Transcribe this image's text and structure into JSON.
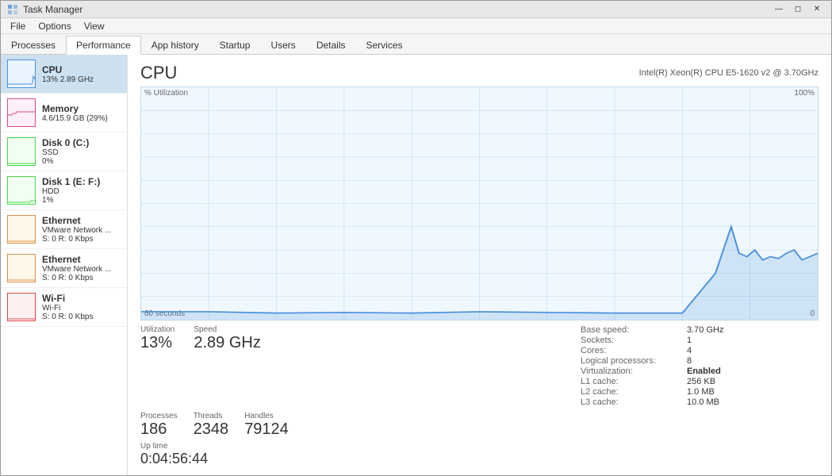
{
  "window": {
    "title": "Task Manager"
  },
  "menu": {
    "items": [
      "File",
      "Options",
      "View"
    ]
  },
  "tabs": [
    {
      "label": "Processes",
      "active": false
    },
    {
      "label": "Performance",
      "active": true
    },
    {
      "label": "App history",
      "active": false
    },
    {
      "label": "Startup",
      "active": false
    },
    {
      "label": "Users",
      "active": false
    },
    {
      "label": "Details",
      "active": false
    },
    {
      "label": "Services",
      "active": false
    }
  ],
  "sidebar": {
    "items": [
      {
        "id": "cpu",
        "title": "CPU",
        "sub": "13%  2.89 GHz",
        "active": true
      },
      {
        "id": "memory",
        "title": "Memory",
        "sub": "4.6/15.9 GB (29%)",
        "active": false
      },
      {
        "id": "disk0",
        "title": "Disk 0 (C:)",
        "sub1": "SSD",
        "sub2": "0%",
        "active": false
      },
      {
        "id": "disk1",
        "title": "Disk 1 (E: F:)",
        "sub1": "HDD",
        "sub2": "1%",
        "active": false
      },
      {
        "id": "eth1",
        "title": "Ethernet",
        "sub1": "VMware Network ...",
        "sub2": "S: 0  R: 0 Kbps",
        "active": false
      },
      {
        "id": "eth2",
        "title": "Ethernet",
        "sub1": "VMware Network ...",
        "sub2": "S: 0  R: 0 Kbps",
        "active": false
      },
      {
        "id": "wifi",
        "title": "Wi-Fi",
        "sub1": "Wi-Fi",
        "sub2": "S: 0  R: 0 Kbps",
        "active": false
      }
    ]
  },
  "detail": {
    "title": "CPU",
    "cpu_name": "Intel(R) Xeon(R) CPU E5-1620 v2 @ 3.70GHz",
    "chart_label_x": "% Utilization",
    "chart_label_60s": "60 seconds",
    "chart_pct_100": "100%",
    "chart_pct_0": "0",
    "utilization_label": "Utilization",
    "utilization_value": "13%",
    "speed_label": "Speed",
    "speed_value": "2.89 GHz",
    "processes_label": "Processes",
    "processes_value": "186",
    "threads_label": "Threads",
    "threads_value": "2348",
    "handles_label": "Handles",
    "handles_value": "79124",
    "uptime_label": "Up time",
    "uptime_value": "0:04:56:44",
    "stats": {
      "base_speed_label": "Base speed:",
      "base_speed_value": "3.70 GHz",
      "sockets_label": "Sockets:",
      "sockets_value": "1",
      "cores_label": "Cores:",
      "cores_value": "4",
      "logical_label": "Logical processors:",
      "logical_value": "8",
      "virt_label": "Virtualization:",
      "virt_value": "Enabled",
      "l1_label": "L1 cache:",
      "l1_value": "256 KB",
      "l2_label": "L2 cache:",
      "l2_value": "1.0 MB",
      "l3_label": "L3 cache:",
      "l3_value": "10.0 MB"
    }
  }
}
